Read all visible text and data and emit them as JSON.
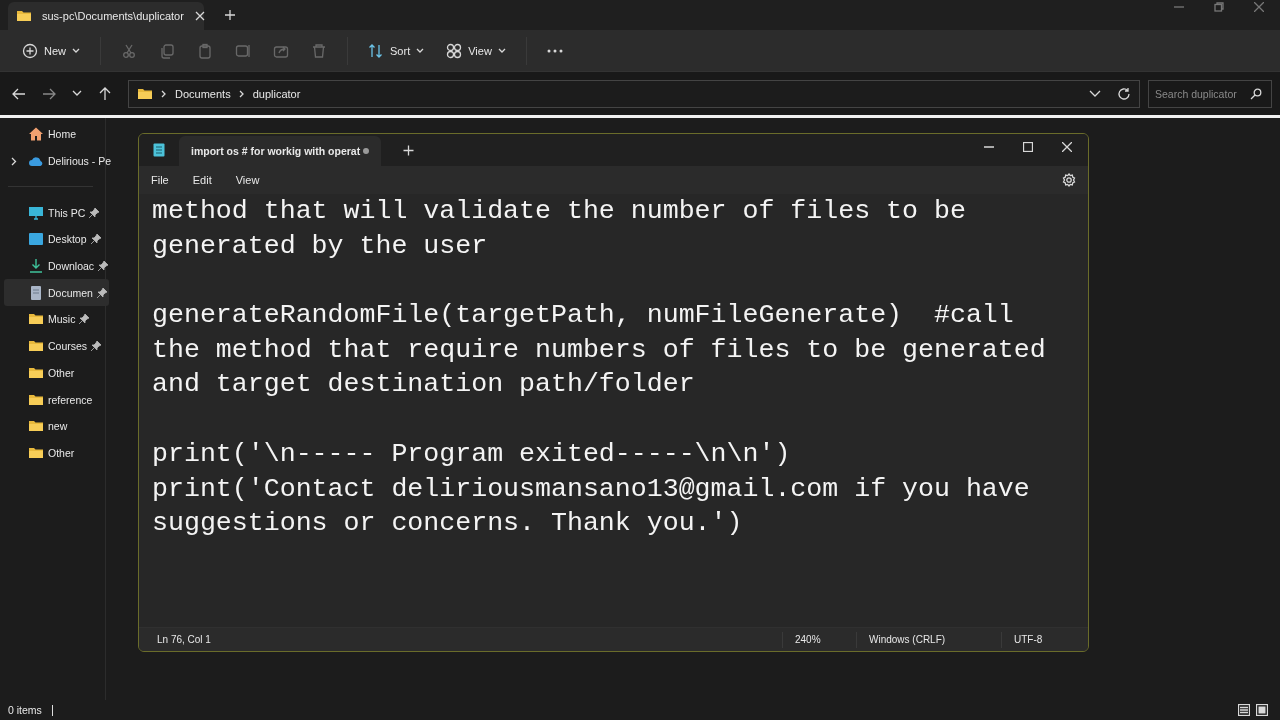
{
  "explorer": {
    "tab": {
      "title": "sus-pc\\Documents\\duplicator"
    },
    "toolbar": [
      {
        "kind": "new",
        "label": "New",
        "disabled": false
      },
      {
        "kind": "cut",
        "disabled": true
      },
      {
        "kind": "copy",
        "disabled": true
      },
      {
        "kind": "paste",
        "disabled": true
      },
      {
        "kind": "rename",
        "disabled": true
      },
      {
        "kind": "share",
        "disabled": true
      },
      {
        "kind": "delete",
        "disabled": true
      },
      {
        "kind": "sort",
        "label": "Sort",
        "disabled": false
      },
      {
        "kind": "view",
        "label": "View",
        "disabled": false
      },
      {
        "kind": "more",
        "disabled": false
      }
    ],
    "breadcrumb": [
      "Documents",
      "duplicator"
    ],
    "search": {
      "placeholder": "Search duplicator"
    },
    "sidebar": [
      {
        "kind": "home",
        "label": "Home",
        "pinned": false,
        "selected": false,
        "expandable": false
      },
      {
        "kind": "cloud",
        "label": "Delirious - Pe",
        "pinned": false,
        "selected": false,
        "expandable": true
      },
      {
        "kind": "pc",
        "label": "This PC",
        "pinned": true,
        "selected": false,
        "expandable": false
      },
      {
        "kind": "desktop",
        "label": "Desktop",
        "pinned": true,
        "selected": false,
        "expandable": false
      },
      {
        "kind": "download",
        "label": "Downloac",
        "pinned": true,
        "selected": false,
        "expandable": false
      },
      {
        "kind": "documents",
        "label": "Documen",
        "pinned": true,
        "selected": true,
        "expandable": false
      },
      {
        "kind": "folder",
        "label": "Music",
        "pinned": true,
        "selected": false,
        "expandable": false
      },
      {
        "kind": "folder",
        "label": "Courses",
        "pinned": true,
        "selected": false,
        "expandable": false
      },
      {
        "kind": "folder",
        "label": "Other",
        "pinned": false,
        "selected": false,
        "expandable": false
      },
      {
        "kind": "folder",
        "label": "reference",
        "pinned": false,
        "selected": false,
        "expandable": false
      },
      {
        "kind": "folder",
        "label": "new",
        "pinned": false,
        "selected": false,
        "expandable": false
      },
      {
        "kind": "folder",
        "label": "Other",
        "pinned": false,
        "selected": false,
        "expandable": false
      }
    ],
    "status": "0 items"
  },
  "notepad": {
    "tab": {
      "title": "import os # for workig with operat",
      "modified": true
    },
    "menu": [
      "File",
      "Edit",
      "View"
    ],
    "blocks": [
      [
        "method that will validate the number of files to be",
        "generated by the user"
      ],
      [
        "generateRandomFile(targetPath, numFileGenerate)  #call",
        "the method that require numbers of files to be generated",
        "and target destination path/folder"
      ],
      [
        "print('\\n----- Program exited-----\\n\\n')",
        "print('Contact deliriousmansano13@gmail.com if you have",
        "suggestions or concerns. Thank you.')"
      ]
    ],
    "status": {
      "position": "Ln 76, Col 1",
      "zoom": "240%",
      "line_ending": "Windows (CRLF)",
      "encoding": "UTF-8"
    }
  }
}
